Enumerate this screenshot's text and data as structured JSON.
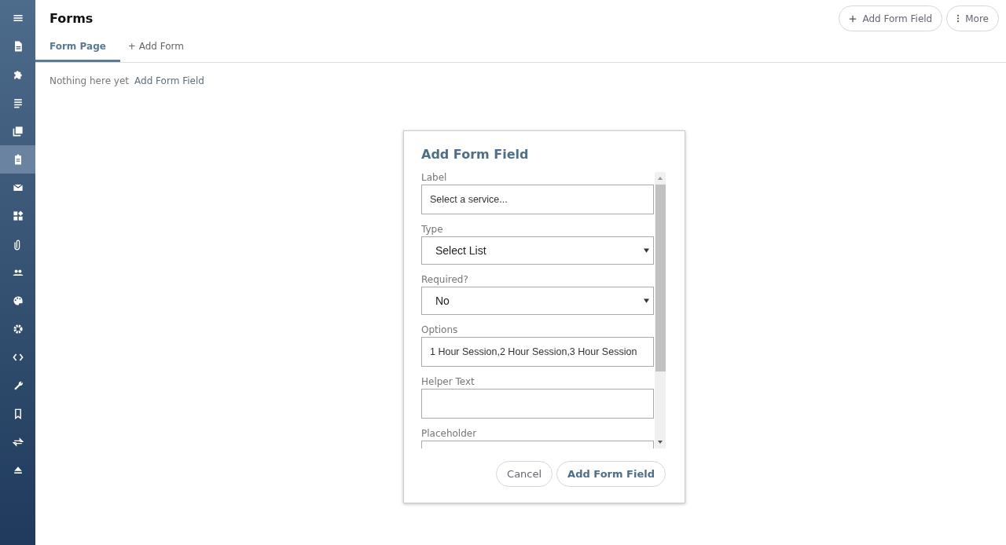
{
  "sidebar": {
    "items": [
      {
        "selected": false
      },
      {
        "selected": false
      },
      {
        "selected": false
      },
      {
        "selected": false
      },
      {
        "selected": false
      },
      {
        "selected": true
      },
      {
        "selected": false
      },
      {
        "selected": false
      },
      {
        "selected": false
      },
      {
        "selected": false
      },
      {
        "selected": false
      },
      {
        "selected": false
      },
      {
        "selected": false
      },
      {
        "selected": false
      },
      {
        "selected": false
      },
      {
        "selected": false
      },
      {
        "selected": false
      }
    ]
  },
  "header": {
    "title": "Forms",
    "actions": [
      {
        "kind": "add",
        "label": "Add Form Field"
      },
      {
        "kind": "more",
        "label": "More"
      }
    ]
  },
  "tabs": [
    {
      "label": "Form Page",
      "selected": true,
      "kind": "tab"
    },
    {
      "label": "+ Add Form",
      "selected": false,
      "kind": "add"
    }
  ],
  "empty_state": {
    "text": "Nothing here yet",
    "link": "Add Form Field"
  },
  "dialog": {
    "title": "Add Form Field",
    "fields": [
      {
        "label": "Label",
        "kind": "text",
        "value": "Select a service..."
      },
      {
        "label": "Type",
        "kind": "select",
        "value": "Select List"
      },
      {
        "label": "Required?",
        "kind": "select",
        "value": "No"
      },
      {
        "label": "Options",
        "kind": "text",
        "value": "1 Hour Session,2 Hour Session,3 Hour Session"
      },
      {
        "label": "Helper Text",
        "kind": "text"
      },
      {
        "label": "Placeholder",
        "kind": "text"
      }
    ],
    "buttons": [
      {
        "kind": "secondary",
        "label": "Cancel"
      },
      {
        "kind": "primary",
        "label": "Add Form Field"
      }
    ]
  }
}
